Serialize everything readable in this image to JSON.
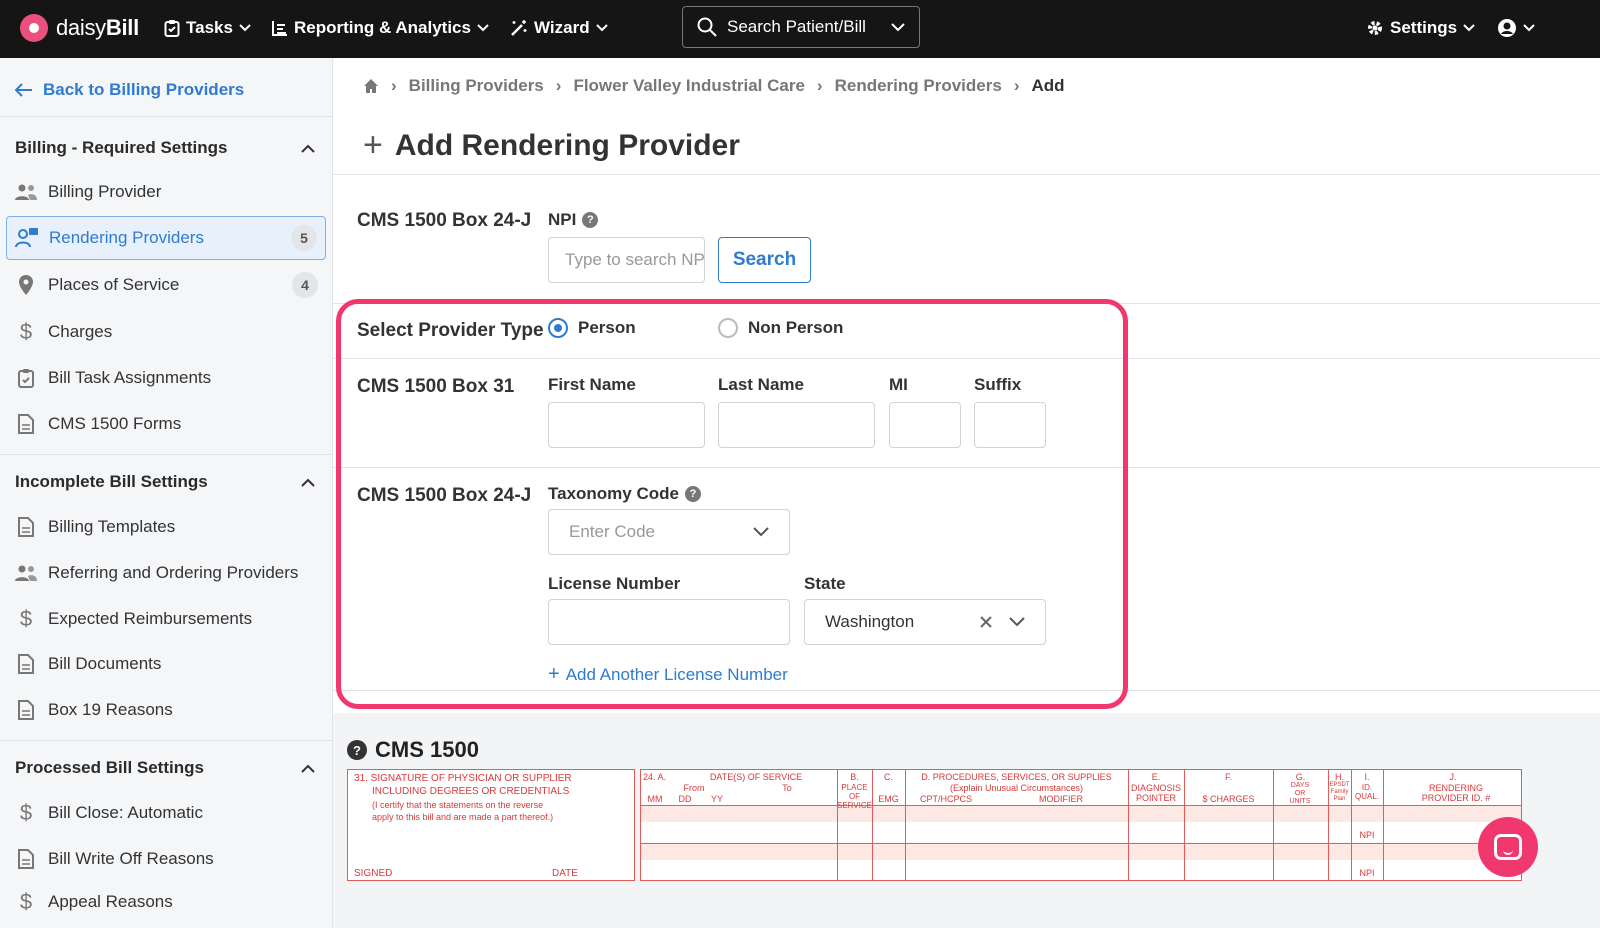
{
  "app": {
    "brand_light": "daisy",
    "brand_bold": "Bill"
  },
  "nav": {
    "tasks": "Tasks",
    "reporting": "Reporting & Analytics",
    "wizard": "Wizard",
    "search": "Search Patient/Bill",
    "settings": "Settings"
  },
  "sidebar": {
    "back": "Back to Billing Providers",
    "sections": [
      {
        "title": "Billing - Required Settings",
        "items": [
          {
            "label": "Billing Provider",
            "icon": "users-icon"
          },
          {
            "label": "Rendering Providers",
            "icon": "provider-icon",
            "badge": "5"
          },
          {
            "label": "Places of Service",
            "icon": "map-pin-icon",
            "badge": "4"
          },
          {
            "label": "Charges",
            "icon": "dollar-icon"
          },
          {
            "label": "Bill Task Assignments",
            "icon": "clipboard-icon"
          },
          {
            "label": "CMS 1500 Forms",
            "icon": "document-icon"
          }
        ]
      },
      {
        "title": "Incomplete Bill Settings",
        "items": [
          {
            "label": "Billing Templates",
            "icon": "document-icon"
          },
          {
            "label": "Referring and Ordering Providers",
            "icon": "users-icon"
          },
          {
            "label": "Expected Reimbursements",
            "icon": "dollar-icon"
          },
          {
            "label": "Bill Documents",
            "icon": "document-icon"
          },
          {
            "label": "Box 19 Reasons",
            "icon": "document-icon"
          }
        ]
      },
      {
        "title": "Processed Bill Settings",
        "items": [
          {
            "label": "Bill Close: Automatic",
            "icon": "dollar-icon"
          },
          {
            "label": "Bill Write Off Reasons",
            "icon": "document-icon"
          },
          {
            "label": "Appeal Reasons",
            "icon": "dollar-icon"
          }
        ]
      }
    ]
  },
  "breadcrumb": [
    "Billing Providers",
    "Flower Valley Industrial Care",
    "Rendering Providers",
    "Add"
  ],
  "page": {
    "title": "Add Rendering Provider"
  },
  "form": {
    "npi_row_label": "CMS 1500 Box 24-J",
    "npi_label": "NPI",
    "npi_placeholder": "Type to search NPI",
    "search_button": "Search",
    "provider_type_label": "Select Provider Type",
    "provider_type_options": [
      "Person",
      "Non Person"
    ],
    "provider_type_selected": "Person",
    "box31_label": "CMS 1500 Box 31",
    "first_name_label": "First Name",
    "last_name_label": "Last Name",
    "mi_label": "MI",
    "suffix_label": "Suffix",
    "taxonomy_row_label": "CMS 1500 Box 24-J",
    "taxonomy_label": "Taxonomy Code",
    "taxonomy_placeholder": "Enter Code",
    "license_label": "License Number",
    "state_label": "State",
    "state_value": "Washington",
    "add_license": "Add Another License Number"
  },
  "cms": {
    "title": "CMS 1500",
    "box31_lines": [
      "31. SIGNATURE OF PHYSICIAN OR SUPPLIER",
      "INCLUDING DEGREES OR CREDENTIALS",
      "(I certify that the statements on the reverse",
      "apply to this bill and are made a part thereof.)"
    ],
    "signed": "SIGNED",
    "date": "DATE",
    "col_24a": "24. A.",
    "col_dates": "DATE(S) OF SERVICE",
    "col_from": "From",
    "col_to": "To",
    "col_mm": "MM",
    "col_dd": "DD",
    "col_yy": "YY",
    "col_b": "B.",
    "col_place": "PLACE OF SERVICE",
    "col_c": "C.",
    "col_emg": "EMG",
    "col_d": "D. PROCEDURES, SERVICES, OR SUPPLIES",
    "col_d_sub": "(Explain Unusual Circumstances)",
    "col_cpt": "CPT/HCPCS",
    "col_modifier": "MODIFIER",
    "col_e": "E.",
    "col_diag": "DIAGNOSIS POINTER",
    "col_f": "F.",
    "col_charges": "$ CHARGES",
    "col_g": "G.",
    "col_days": "DAYS OR UNITS",
    "col_h": "H.",
    "col_epsdt": "EPSDT Family Plan",
    "col_i": "I.",
    "col_idqual": "ID. QUAL.",
    "col_j": "J.",
    "col_rendering": "RENDERING PROVIDER ID. #",
    "npi": "NPI"
  },
  "colors": {
    "accent": "#2e7bd0",
    "highlight": "#f0386f",
    "nav_bg": "#151515",
    "form_red": "#d93a3a"
  }
}
